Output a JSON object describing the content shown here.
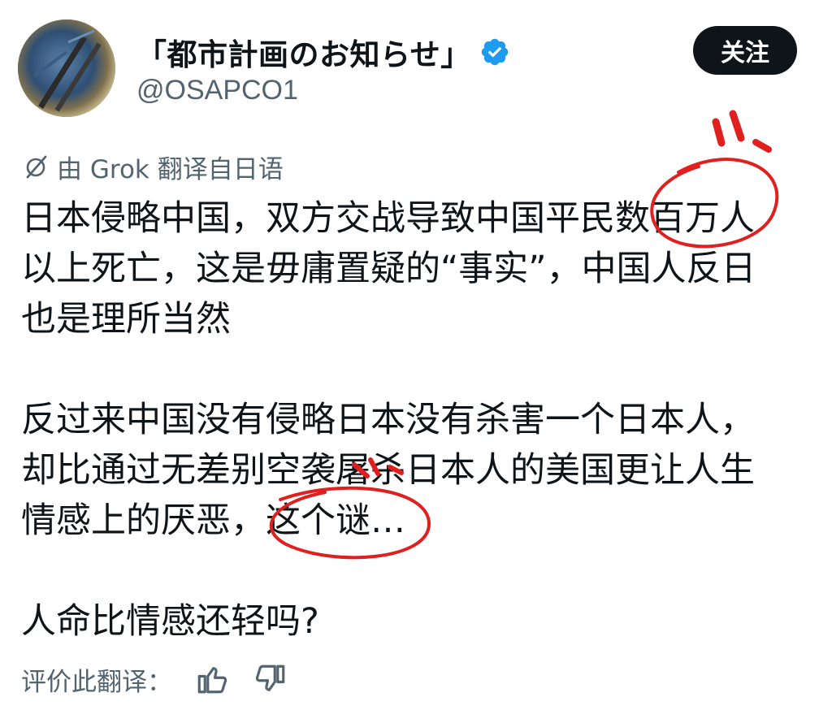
{
  "header": {
    "display_name": "「都市計画のお知らせ」",
    "handle": "@OSAPCO1",
    "follow_label": "关注",
    "verified": true
  },
  "translation": {
    "notice": "由 Grok 翻译自日语"
  },
  "tweet": {
    "paragraphs": [
      {
        "lines": [
          "日本侵略中国，双方交战导致中国平民数百万人",
          "以上死亡，这是毋庸置疑的“事实”，中国人反日",
          "也是理所当然"
        ]
      },
      {
        "lines": [
          "反过来中国没有侵略日本没有杀害一个日本人，",
          "却比通过无差别空袭屠杀日本人的美国更让人生",
          "情感上的厌恶，这个谜…"
        ]
      },
      {
        "lines": [
          "人命比情感还轻吗?"
        ]
      }
    ]
  },
  "rating": {
    "label": "评价此翻译："
  },
  "colors": {
    "text": "#0f1419",
    "secondary": "#536471",
    "verified": "#1d9bf0",
    "annotation": "#e0201e",
    "button_bg": "#0f1419"
  },
  "icons": {
    "translate": "grok-slash-icon",
    "like": "thumbs-up-icon",
    "dislike": "thumbs-down-icon",
    "verified": "verified-badge-icon"
  }
}
